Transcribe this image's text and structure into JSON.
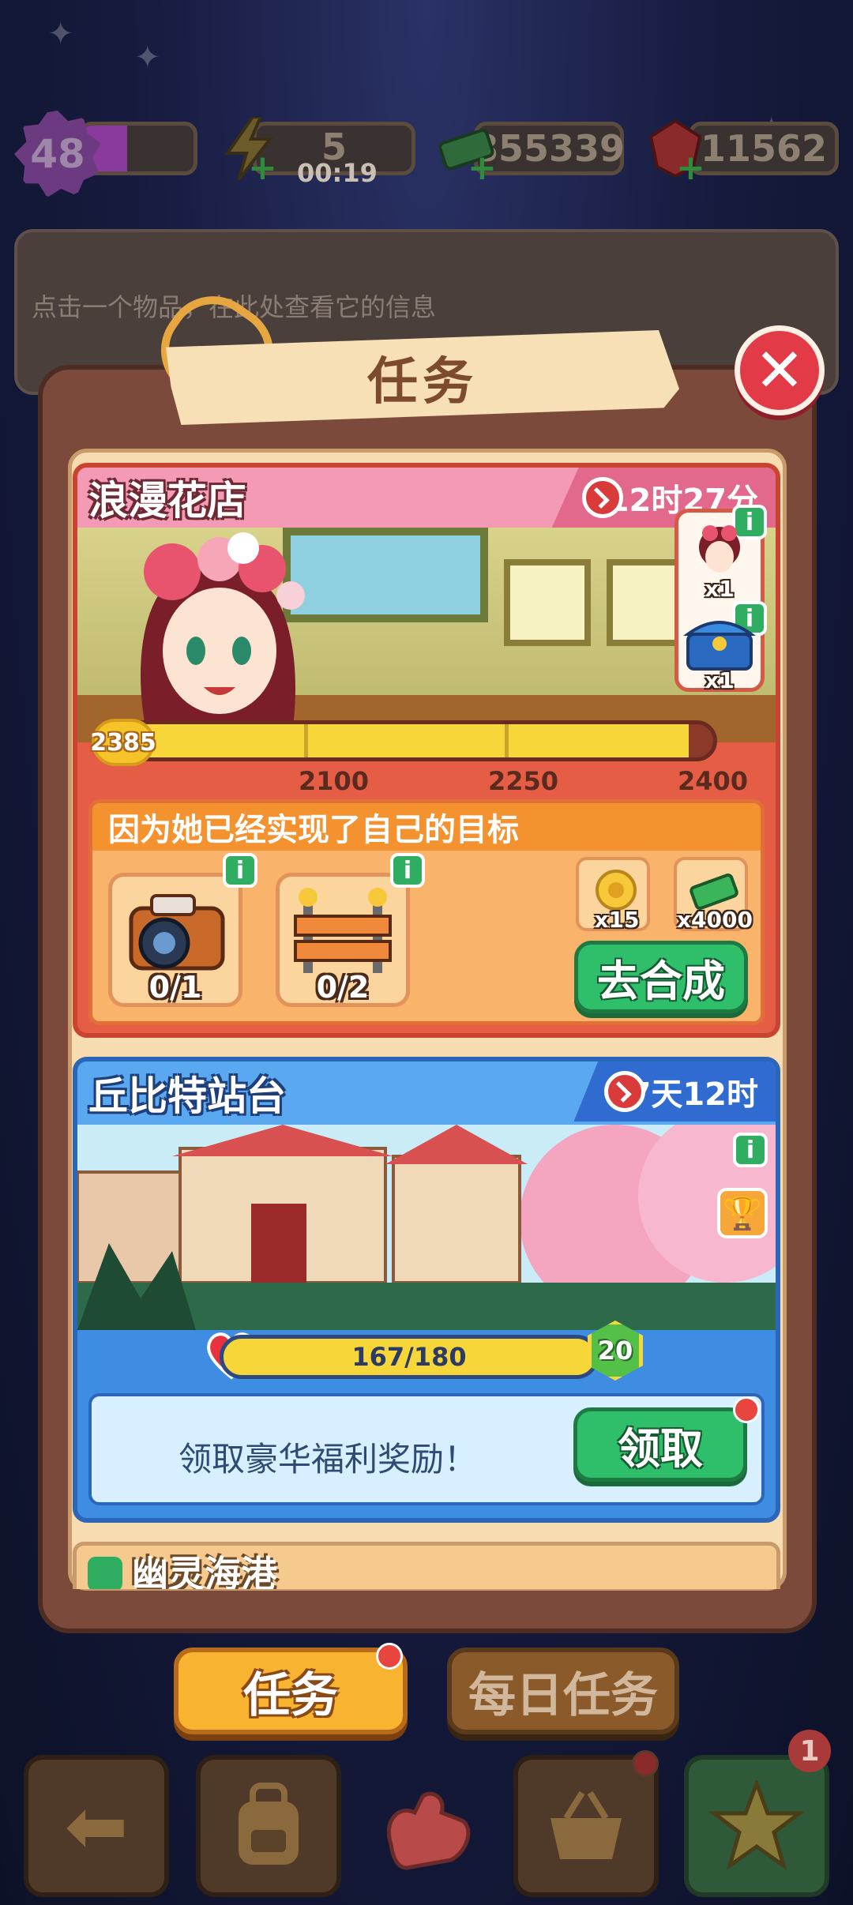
{
  "hud": {
    "level": "48",
    "energy": "5",
    "energy_timer": "00:19",
    "cash": "855339",
    "gems": "11562",
    "xp_fraction": 0.4
  },
  "info_strip": {
    "text": "点击一个物品，在此处查看它的信息"
  },
  "modal": {
    "title": "任务",
    "close_label": "✕"
  },
  "task1": {
    "name": "浪漫花店",
    "timer": "12时27分",
    "current_points": "2385",
    "milestones": [
      "2100",
      "2250",
      "2400"
    ],
    "progress_fraction": 0.96,
    "reward_tags": [
      "x1",
      "x1"
    ],
    "goal_text": "因为她已经实现了自己的目标",
    "items": [
      {
        "name": "camera",
        "count": "0/1"
      },
      {
        "name": "road-barrier",
        "count": "0/2"
      }
    ],
    "rewards": [
      {
        "name": "gold-rose",
        "qty": "x15"
      },
      {
        "name": "cash-stack",
        "qty": "x4000"
      }
    ],
    "action_label": "去合成",
    "accent_color": "#f49ab4"
  },
  "task2": {
    "name": "丘比特站台",
    "timer": "7天12时",
    "hearts": "167/180",
    "hearts_fraction": 0.93,
    "level": "20",
    "claim_text": "领取豪华福利奖励！",
    "claim_label": "领取",
    "accent_color": "#3f8de3"
  },
  "task3": {
    "name": "幽灵海港"
  },
  "tabs": {
    "active": "任务",
    "inactive": "每日任务"
  },
  "nav": {
    "badge": "1",
    "icons": [
      "back-arrow-icon",
      "backpack-icon",
      "glove-icon",
      "basket-icon",
      "star-icon"
    ]
  }
}
